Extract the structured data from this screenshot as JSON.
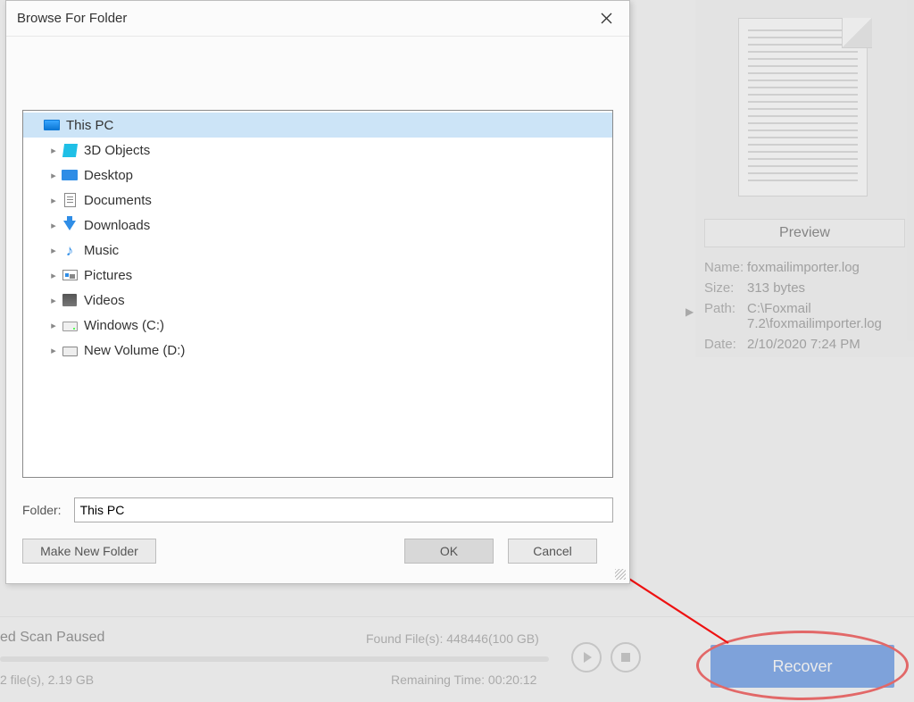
{
  "dialog": {
    "title": "Browse For Folder",
    "folderLabel": "Folder:",
    "folderValue": "This PC",
    "makeNewFolder": "Make New Folder",
    "ok": "OK",
    "cancel": "Cancel",
    "tree": {
      "root": "This PC",
      "items": [
        {
          "label": "3D Objects",
          "icon": "3d"
        },
        {
          "label": "Desktop",
          "icon": "desktop"
        },
        {
          "label": "Documents",
          "icon": "doc"
        },
        {
          "label": "Downloads",
          "icon": "down"
        },
        {
          "label": "Music",
          "icon": "music"
        },
        {
          "label": "Pictures",
          "icon": "pic"
        },
        {
          "label": "Videos",
          "icon": "video"
        },
        {
          "label": "Windows (C:)",
          "icon": "drive"
        },
        {
          "label": "New Volume (D:)",
          "icon": "hdd"
        }
      ]
    }
  },
  "preview": {
    "button": "Preview",
    "nameLabel": "Name:",
    "nameValue": "foxmailimporter.log",
    "sizeLabel": "Size:",
    "sizeValue": "313 bytes",
    "pathLabel": "Path:",
    "pathValue": "C:\\Foxmail 7.2\\foxmailimporter.log",
    "dateLabel": "Date:",
    "dateValue": "2/10/2020 7:24 PM"
  },
  "status": {
    "title": "ed Scan Paused",
    "found": "Found File(s):  448446(100 GB)",
    "selected": "2 file(s), 2.19 GB",
    "remaining": "Remaining Time:  00:20:12"
  },
  "recover": {
    "label": "Recover"
  }
}
